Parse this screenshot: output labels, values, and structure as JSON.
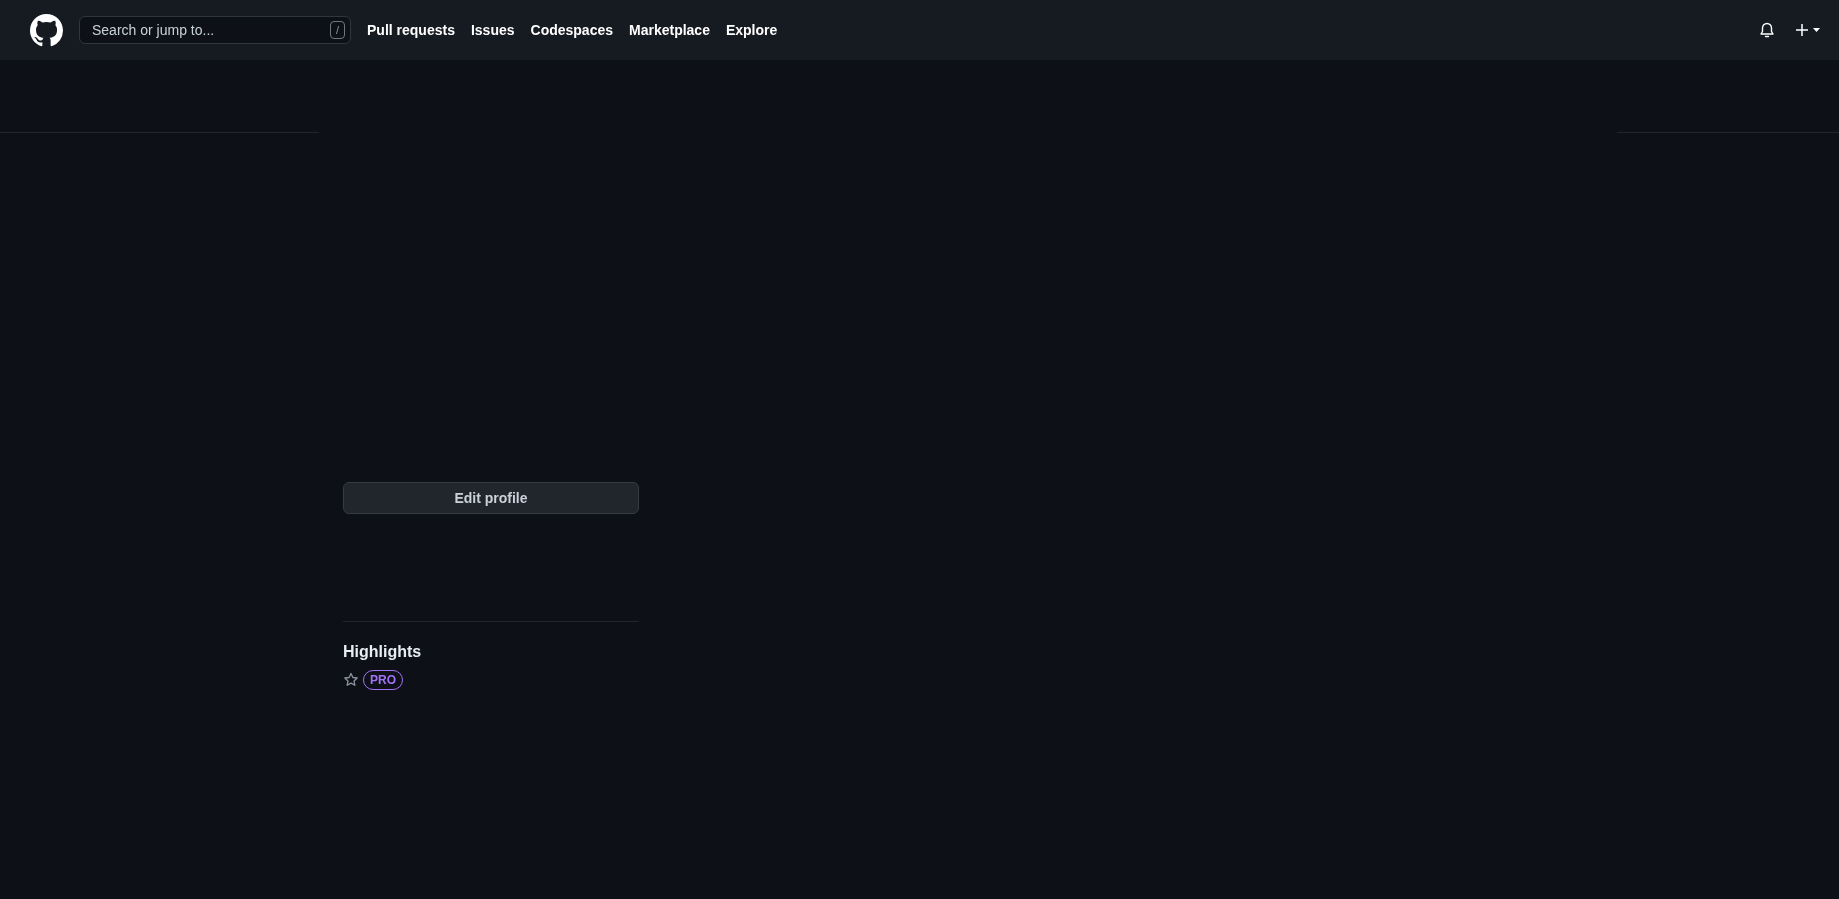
{
  "header": {
    "search": {
      "placeholder": "Search or jump to...",
      "shortcut": "/"
    },
    "nav": [
      "Pull requests",
      "Issues",
      "Codespaces",
      "Marketplace",
      "Explore"
    ]
  },
  "profile": {
    "edit_button": "Edit profile",
    "highlights": {
      "title": "Highlights",
      "badge": "PRO"
    }
  }
}
